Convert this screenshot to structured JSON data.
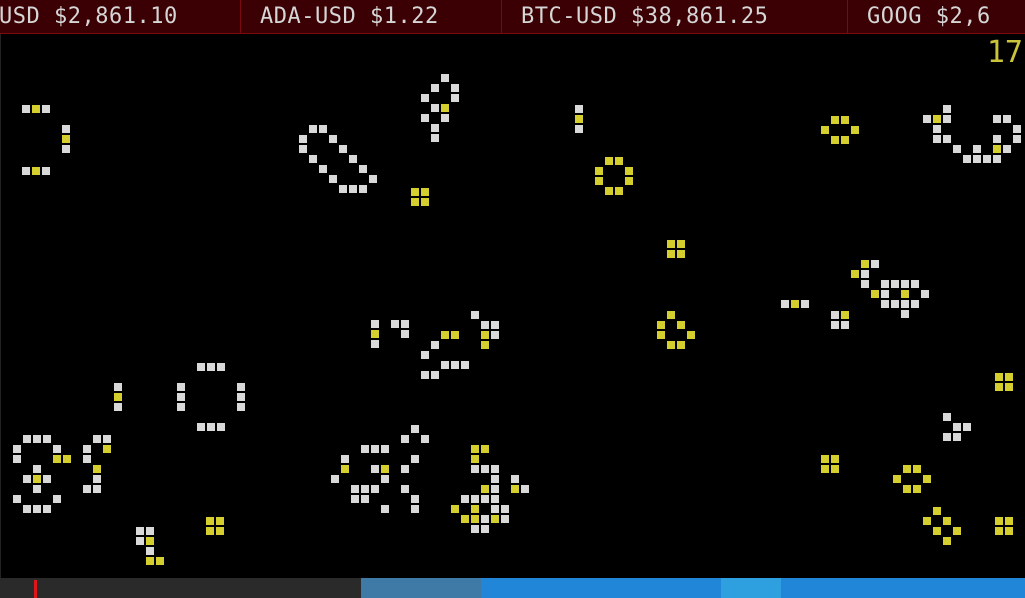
{
  "ticker": {
    "items": [
      {
        "text": "USD $2,861.10"
      },
      {
        "text": "ADA-USD $1.22"
      },
      {
        "text": "BTC-USD $38,861.25"
      },
      {
        "text": "GOOG $2,6"
      }
    ]
  },
  "generation_counter": "17",
  "colors": {
    "live_cell": "#d9d9d9",
    "new_cell": "#d4cf2e",
    "ticker_bg": "#3a0003",
    "status_dark": "#2a2a2a",
    "status_mid": "#3f7aa6",
    "status_bright": "#2185d8",
    "status_light": "#2ea0e0",
    "marker": "#e0141b"
  },
  "icons": {
    "progress_marker": "position-marker-icon"
  }
}
